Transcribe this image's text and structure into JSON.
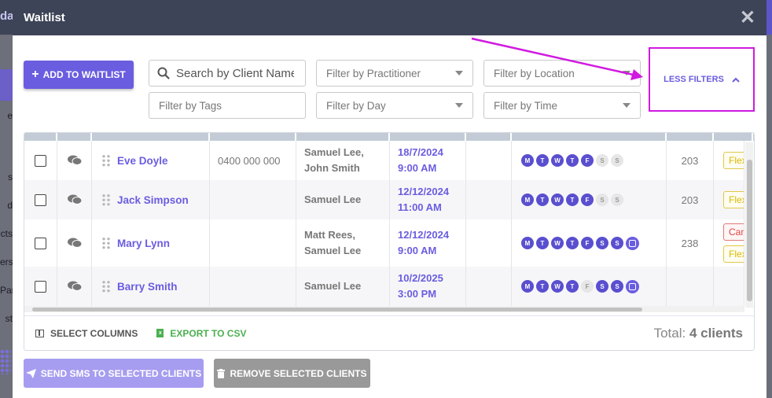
{
  "background": {
    "side_labels": [
      "da",
      "e",
      "s",
      "d",
      "cts",
      "ers",
      "Par",
      "st"
    ],
    "top_letter": "S"
  },
  "modal": {
    "title": "Waitlist",
    "close_glyph": "✕"
  },
  "toolbar": {
    "add_label": "ADD TO WAITLIST",
    "search_placeholder": "Search by Client Name",
    "filters": {
      "practitioner": "Filter by Practitioner",
      "location": "Filter by Location",
      "tags": "Filter by Tags",
      "day": "Filter by Day",
      "time": "Filter by Time"
    },
    "less_filters_label": "LESS FILTERS"
  },
  "table": {
    "rows": [
      {
        "name": "Eve Doyle",
        "phone": "0400 000 000",
        "practitioners": [
          "Samuel Lee,",
          "John Smith"
        ],
        "date": "18/7/2024",
        "time": "9:00 AM",
        "days": [
          {
            "l": "M",
            "on": true
          },
          {
            "l": "T",
            "on": true
          },
          {
            "l": "W",
            "on": true
          },
          {
            "l": "T",
            "on": true
          },
          {
            "l": "F",
            "on": true
          },
          {
            "l": "S",
            "on": false
          },
          {
            "l": "S",
            "on": false
          }
        ],
        "extra_icon": false,
        "number": "203",
        "tags": [
          {
            "text": "Flex",
            "color": "yellow"
          }
        ]
      },
      {
        "name": "Jack Simpson",
        "phone": "",
        "practitioners": [
          "Samuel Lee"
        ],
        "date": "12/12/2024",
        "time": "11:00 AM",
        "days": [
          {
            "l": "M",
            "on": true
          },
          {
            "l": "T",
            "on": true
          },
          {
            "l": "W",
            "on": true
          },
          {
            "l": "T",
            "on": true
          },
          {
            "l": "F",
            "on": true
          },
          {
            "l": "S",
            "on": false
          },
          {
            "l": "S",
            "on": false
          }
        ],
        "extra_icon": false,
        "number": "203",
        "tags": [
          {
            "text": "Flex",
            "color": "yellow"
          }
        ]
      },
      {
        "name": "Mary Lynn",
        "phone": "",
        "practitioners": [
          "Matt Rees,",
          "Samuel Lee"
        ],
        "date": "12/12/2024",
        "time": "9:00 AM",
        "days": [
          {
            "l": "M",
            "on": true
          },
          {
            "l": "T",
            "on": true
          },
          {
            "l": "W",
            "on": true
          },
          {
            "l": "T",
            "on": true
          },
          {
            "l": "F",
            "on": true
          },
          {
            "l": "S",
            "on": true
          },
          {
            "l": "S",
            "on": true
          }
        ],
        "extra_icon": true,
        "number": "238",
        "tags": [
          {
            "text": "Can",
            "color": "red"
          },
          {
            "text": "Flex",
            "color": "yellow"
          }
        ]
      },
      {
        "name": "Barry Smith",
        "phone": "",
        "practitioners": [
          "Samuel Lee"
        ],
        "date": "10/2/2025",
        "time": "3:00 PM",
        "days": [
          {
            "l": "M",
            "on": true
          },
          {
            "l": "T",
            "on": true
          },
          {
            "l": "W",
            "on": true
          },
          {
            "l": "T",
            "on": true
          },
          {
            "l": "F",
            "on": false
          },
          {
            "l": "S",
            "on": true
          },
          {
            "l": "S",
            "on": true
          }
        ],
        "extra_icon": true,
        "number": "",
        "tags": []
      }
    ]
  },
  "footer": {
    "select_columns": "SELECT COLUMNS",
    "export_csv": "EXPORT TO CSV",
    "total_prefix": "Total:",
    "total_value": "4 clients"
  },
  "actions": {
    "send_sms": "SEND SMS TO SELECTED CLIENTS",
    "remove": "REMOVE SELECTED CLIENTS"
  },
  "colors": {
    "accent": "#6a5de0",
    "annotation": "#d01ae0",
    "header": "#3d4457",
    "export_green": "#4caf50"
  }
}
